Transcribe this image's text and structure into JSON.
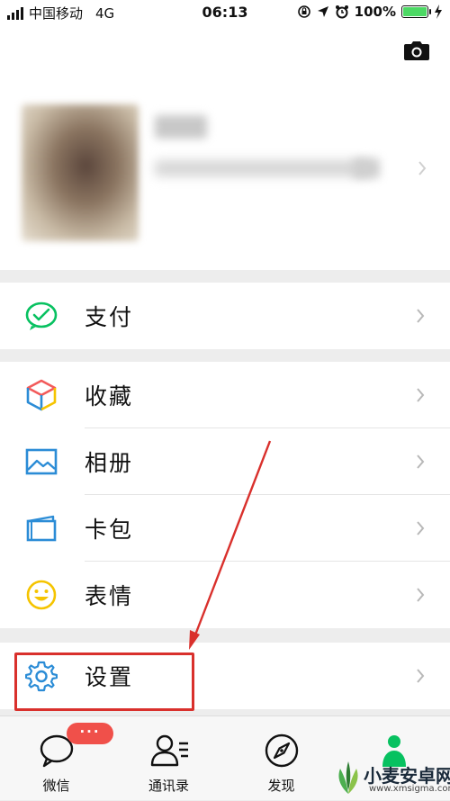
{
  "status_bar": {
    "carrier": "中国移动",
    "network": "4G",
    "time": "06:13",
    "battery": "100%",
    "battery_level": 1.0,
    "battery_color": "#4cd964"
  },
  "profile": {
    "camera_icon": "camera-icon"
  },
  "menu": {
    "pay": {
      "label": "支付",
      "icon": "wechat-pay-icon",
      "color": "#07c160"
    },
    "favorites": {
      "label": "收藏",
      "icon": "cube-icon"
    },
    "album": {
      "label": "相册",
      "icon": "picture-icon",
      "color": "#2b8cd6"
    },
    "cards": {
      "label": "卡包",
      "icon": "wallet-icon",
      "color": "#2b8cd6"
    },
    "stickers": {
      "label": "表情",
      "icon": "smiley-icon",
      "color": "#f5c400"
    },
    "settings": {
      "label": "设置",
      "icon": "gear-icon",
      "color": "#2b8cd6"
    }
  },
  "tabbar": {
    "chats": {
      "label": "微信",
      "badge": "···"
    },
    "contacts": {
      "label": "通讯录"
    },
    "discover": {
      "label": "发现"
    },
    "me": {
      "color": "#07c160"
    }
  },
  "watermark": {
    "brand": "小麦安卓网",
    "url": "www.xmsigma.com"
  },
  "annotation_color": "#d9302c"
}
